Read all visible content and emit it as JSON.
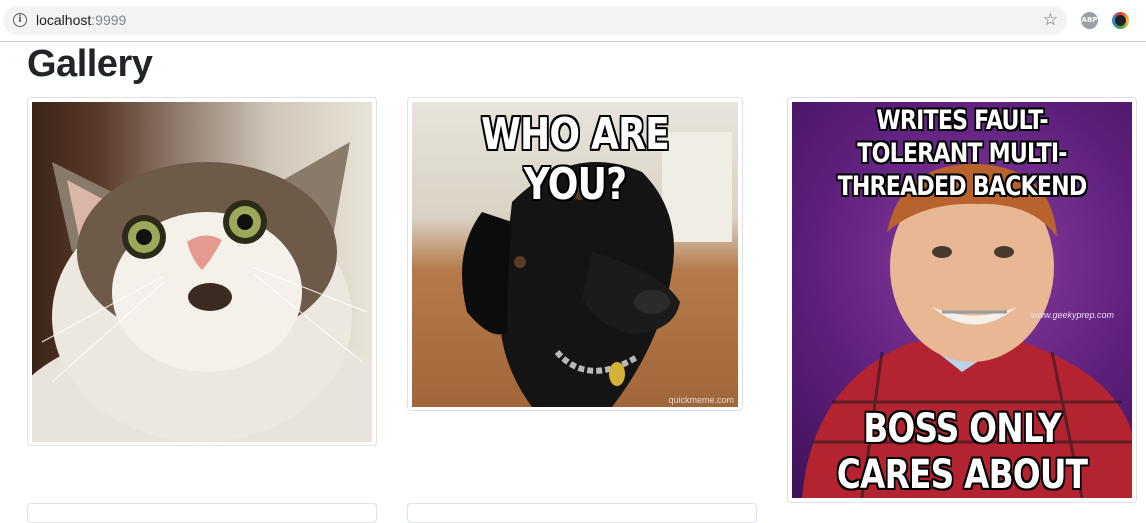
{
  "browser": {
    "url_host": "localhost",
    "url_port": ":9999",
    "icons": [
      "info-icon",
      "star-icon",
      "adblock-plus-icon",
      "extension-icon"
    ],
    "abp_label": "ABP"
  },
  "page": {
    "title": "Gallery"
  },
  "gallery": [
    {
      "subject": "surprised-cat-photo"
    },
    {
      "subject": "black-dog-meme",
      "caption_top": "WHO ARE YOU?",
      "watermark": "quickmeme.com"
    },
    {
      "subject": "bad-luck-brian-meme",
      "caption_top": "WRITES FAULT-TOLERANT MULTI-THREADED BACKEND",
      "caption_bottom": "BOSS ONLY CARES ABOUT CSS",
      "watermark": "www.geekyprep.com"
    }
  ]
}
